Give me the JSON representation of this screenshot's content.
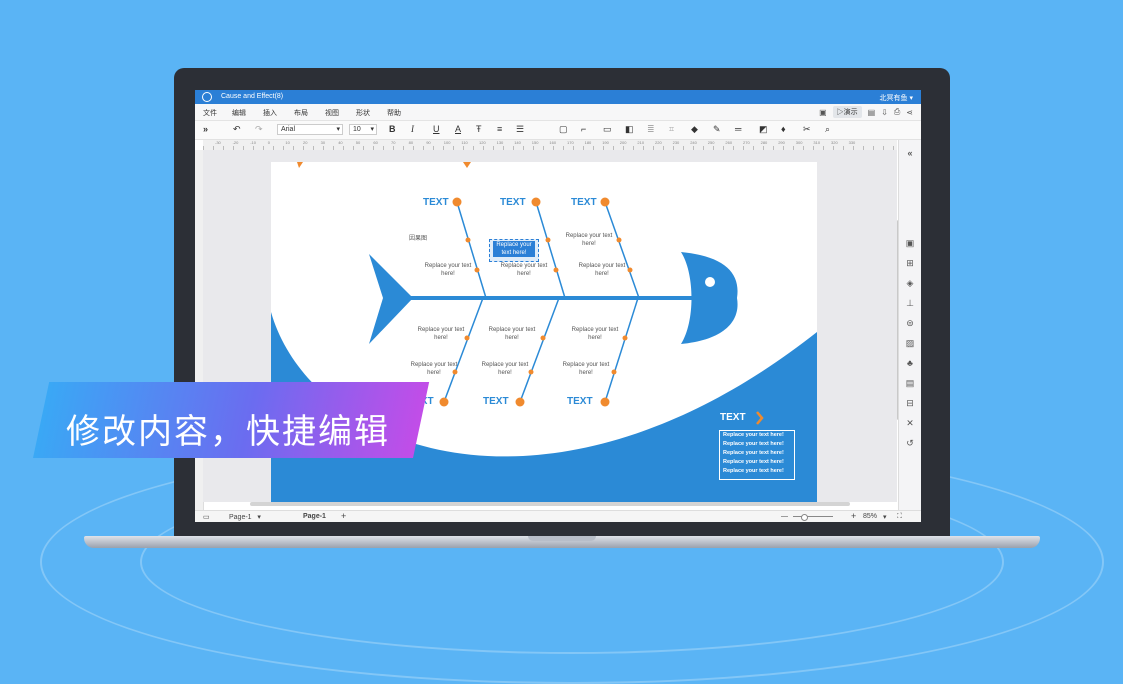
{
  "window": {
    "title": "Cause and Effect(8)",
    "user": "北冥有鱼"
  },
  "menu": [
    "文件",
    "编辑",
    "插入",
    "布局",
    "视图",
    "形状",
    "帮助"
  ],
  "menu_right": {
    "present_label": "演示"
  },
  "toolbar": {
    "font": "Arial",
    "font_size": "10",
    "bold": "B",
    "italic": "I",
    "underline": "U",
    "font_color": "A"
  },
  "ruler_ticks": [
    "-30",
    "-20",
    "-10",
    "0",
    "10",
    "20",
    "30",
    "40",
    "50",
    "60",
    "70",
    "80",
    "90",
    "100",
    "110",
    "120",
    "130",
    "140",
    "150",
    "160",
    "170",
    "180",
    "190",
    "200",
    "210",
    "220",
    "230",
    "240",
    "250",
    "260",
    "270",
    "280",
    "290",
    "300",
    "310",
    "320",
    "330"
  ],
  "diagram": {
    "top_headers": [
      "TEXT",
      "TEXT",
      "TEXT"
    ],
    "bottom_headers": [
      "TEXT",
      "TEXT",
      "TEXT"
    ],
    "cause_label": "因果图",
    "selected_text": "Replace your text here!",
    "branch_text": "Replace your text here!",
    "tail_title": "TEXT",
    "tail_items": [
      "Replace your text here!",
      "Replace your text here!",
      "Replace your text here!",
      "Replace your text here!",
      "Replace your text here!"
    ]
  },
  "status": {
    "page_tab_1": "Page-1",
    "page_tab_2": "Page-1",
    "add": "+",
    "zoom": "85%"
  },
  "banner": {
    "text": "修改内容，快捷编辑"
  },
  "colors": {
    "accent": "#2b7fd6",
    "fish": "#2b8ad6",
    "node": "#f08a2e",
    "background": "#5ab4f5"
  }
}
